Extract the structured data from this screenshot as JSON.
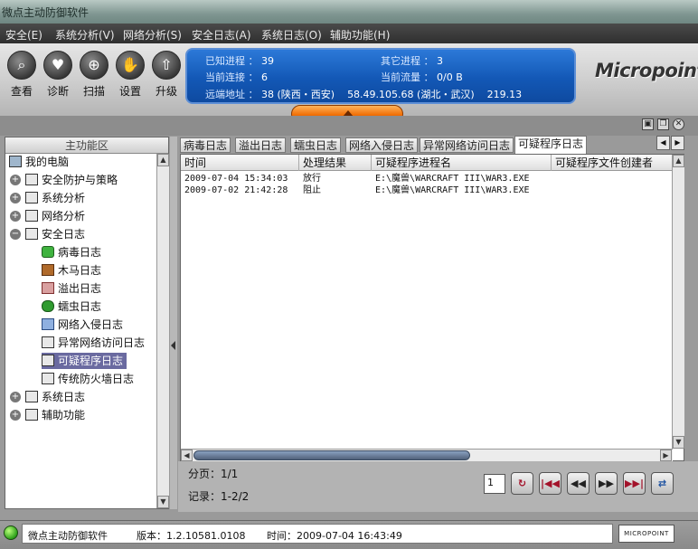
{
  "window": {
    "title": "微点主动防御软件"
  },
  "menu": [
    "安全(E)",
    "系统分析(V)",
    "网络分析(S)",
    "安全日志(A)",
    "系统日志(O)",
    "辅助功能(H)"
  ],
  "toolbar": [
    {
      "label": "查看",
      "icon": "magnifier-icon"
    },
    {
      "label": "诊断",
      "icon": "heart-icon"
    },
    {
      "label": "扫描",
      "icon": "scan-icon"
    },
    {
      "label": "设置",
      "icon": "hand-icon"
    },
    {
      "label": "升级",
      "icon": "upgrade-icon"
    }
  ],
  "status_panel": {
    "known_process_label": "已知进程 ：",
    "known_process_value": "39",
    "other_process_label": "其它进程 ：",
    "other_process_value": "3",
    "connections_label": "当前连接 ：",
    "connections_value": "6",
    "traffic_label": "当前流量 ：",
    "traffic_value": "0/0 B",
    "remote_label": "远端地址 ：",
    "remote_value": "38 (陕西・西安)    58.49.105.68 (湖北・武汉)    219.13"
  },
  "brand": {
    "logo_text": "Micropoint"
  },
  "left_panel": {
    "header": "主功能区",
    "tree": [
      {
        "label": "我的电脑",
        "icon": "computer-icon",
        "level": 0,
        "expander": ""
      },
      {
        "label": "安全防护与策略",
        "icon": "policy-icon",
        "level": 1,
        "expander": "+"
      },
      {
        "label": "系统分析",
        "icon": "window-icon",
        "level": 1,
        "expander": "+"
      },
      {
        "label": "网络分析",
        "icon": "network-icon",
        "level": 1,
        "expander": "+"
      },
      {
        "label": "安全日志",
        "icon": "log-icon",
        "level": 1,
        "expander": "−"
      },
      {
        "label": "病毒日志",
        "icon": "virus-icon",
        "level": 2,
        "expander": ""
      },
      {
        "label": "木马日志",
        "icon": "trojan-icon",
        "level": 2,
        "expander": ""
      },
      {
        "label": "溢出日志",
        "icon": "overflow-icon",
        "level": 2,
        "expander": ""
      },
      {
        "label": "蠕虫日志",
        "icon": "worm-icon",
        "level": 2,
        "expander": ""
      },
      {
        "label": "网络入侵日志",
        "icon": "sword-icon",
        "level": 2,
        "expander": ""
      },
      {
        "label": "异常网络访问日志",
        "icon": "doc-icon",
        "level": 2,
        "expander": ""
      },
      {
        "label": "可疑程序日志",
        "icon": "doc-icon",
        "level": 2,
        "expander": "",
        "selected": true
      },
      {
        "label": "传统防火墙日志",
        "icon": "doc-icon",
        "level": 2,
        "expander": ""
      },
      {
        "label": "系统日志",
        "icon": "syslog-icon",
        "level": 1,
        "expander": "+"
      },
      {
        "label": "辅助功能",
        "icon": "tools-icon",
        "level": 1,
        "expander": "+"
      }
    ]
  },
  "tabs": [
    "病毒日志",
    "溢出日志",
    "蠕虫日志",
    "网络入侵日志",
    "异常网络访问日志",
    "可疑程序日志"
  ],
  "active_tab": "可疑程序日志",
  "table": {
    "columns": [
      "时间",
      "处理结果",
      "可疑程序进程名",
      "可疑程序文件创建者"
    ],
    "rows": [
      [
        "2009-07-04 15:34:03",
        "放行",
        "E:\\魔兽\\WARCRAFT III\\WAR3.EXE",
        ""
      ],
      [
        "2009-07-02 21:42:28",
        "阻止",
        "E:\\魔兽\\WARCRAFT III\\WAR3.EXE",
        ""
      ]
    ]
  },
  "pagination": {
    "page_label": "分页：1/1",
    "record_label": "记录：1-2/2",
    "page_input": "1",
    "buttons": [
      "refresh-icon",
      "first-page-icon",
      "prev-page-icon",
      "next-page-icon",
      "last-page-icon",
      "sync-icon"
    ]
  },
  "statusbar": {
    "app_name": "微点主动防御软件",
    "version": "版本：1.2.10581.0108",
    "time": "时间：2009-07-04 16:43:49",
    "logo": "MICROPOINT"
  }
}
